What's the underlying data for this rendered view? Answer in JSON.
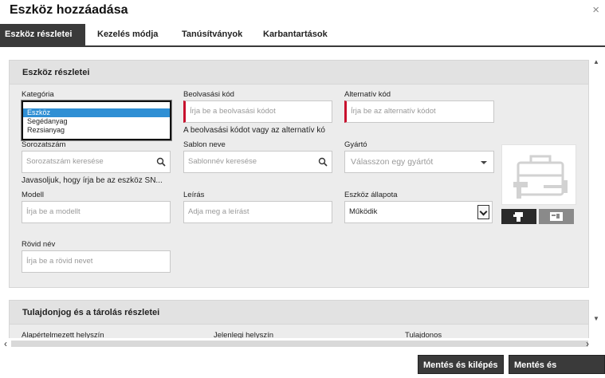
{
  "dialog": {
    "title": "Eszköz hozzáadása",
    "close_symbol": "×"
  },
  "tabs": [
    {
      "label": "Eszköz részletei",
      "active": true
    },
    {
      "label": "Kezelés módja",
      "active": false
    },
    {
      "label": "Tanúsítványok",
      "active": false
    },
    {
      "label": "Karbantartások",
      "active": false
    }
  ],
  "details": {
    "header": "Eszköz részletei",
    "category": {
      "label": "Kategória",
      "options": [
        "Eszköz",
        "Segédanyag",
        "Rezsianyag"
      ],
      "selected": "Eszköz"
    },
    "scan_code": {
      "label": "Beolvasási kód",
      "placeholder": "Írja be a beolvasási kódot",
      "hint": "A beolvasási kódot vagy az alternatív kó"
    },
    "alt_code": {
      "label": "Alternatív kód",
      "placeholder": "Írja be az alternatív kódot"
    },
    "serial": {
      "label": "Sorozatszám",
      "placeholder": "Sorozatszám keresése",
      "hint": "Javasoljuk, hogy írja be az eszköz SN..."
    },
    "template": {
      "label": "Sablon neve",
      "placeholder": "Sablonnév keresése"
    },
    "manufacturer": {
      "label": "Gyártó",
      "placeholder": "Válasszon egy gyártót"
    },
    "model": {
      "label": "Modell",
      "placeholder": "Írja be a modellt"
    },
    "description": {
      "label": "Leírás",
      "placeholder": "Adja meg a leírást"
    },
    "status": {
      "label": "Eszköz állapota",
      "value": "Működik"
    },
    "short_name": {
      "label": "Rövid név",
      "placeholder": "Írja be a rövid nevet"
    },
    "image_icons": {
      "placeholder": "toolbox-with-tools-icon",
      "button_1": "upload-tool-image-icon",
      "button_2": "id-card-icon"
    }
  },
  "ownership": {
    "header": "Tulajdonjog és a tárolás részletei",
    "default_location_label": "Alapértelmezett helyszín",
    "current_location_label": "Jelenlegi helyszín",
    "owner_label": "Tulajdonos"
  },
  "footer": {
    "save_exit": "Mentés és kilépés",
    "save_next": "Mentés és következő"
  },
  "colors": {
    "dark": "#3a3a3a",
    "required": "#c8102e",
    "selection": "#2f8fd4",
    "section_bg": "#ececec"
  }
}
